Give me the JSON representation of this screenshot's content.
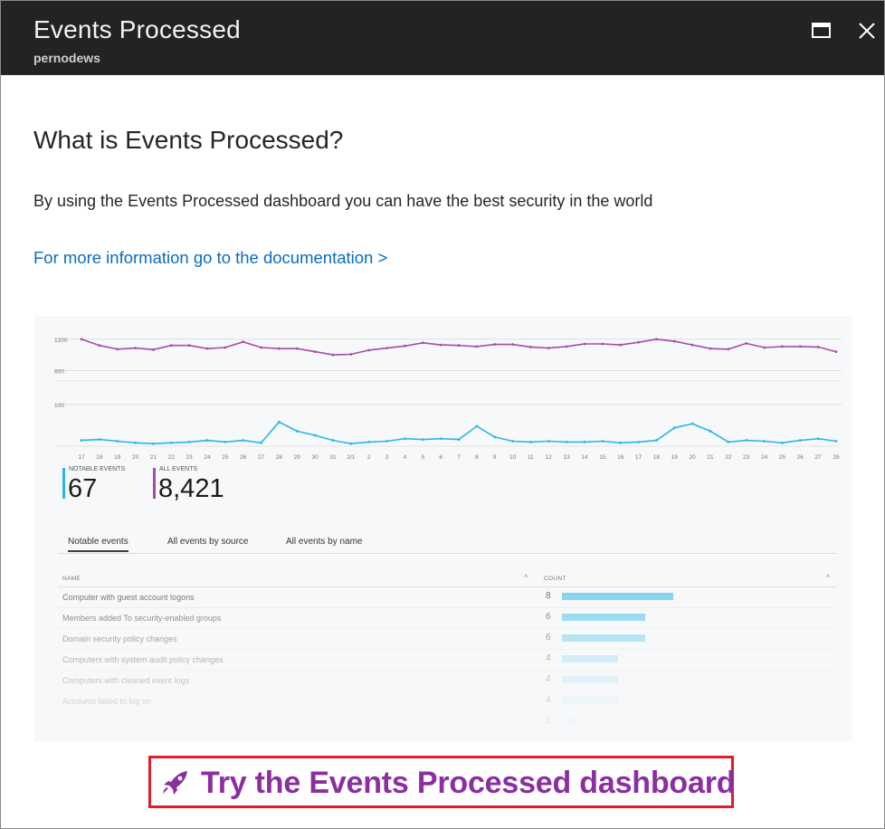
{
  "window": {
    "title": "Events Processed",
    "subtitle": "pernodews"
  },
  "content": {
    "heading": "What is Events Processed?",
    "description": "By using the Events Processed dashboard you can have the best security in the world",
    "doc_link": "For more information go to the documentation >"
  },
  "preview": {
    "notable": {
      "label": "NOTABLE EVENTS",
      "value": "67",
      "color": "#29b6e8"
    },
    "all": {
      "label": "ALL EVENTS",
      "value": "8,421",
      "color": "#a64ca6"
    },
    "tabs": [
      "Notable events",
      "All events by source",
      "All events by name"
    ],
    "columns": {
      "name": "NAME",
      "count": "COUNT"
    },
    "rows": [
      {
        "name": "Computer with guest account logons",
        "count": 8
      },
      {
        "name": "Members added To security-enabled groups",
        "count": 6
      },
      {
        "name": "Domain security policy changes",
        "count": 6
      },
      {
        "name": "Computers with system audit policy changes",
        "count": 4
      },
      {
        "name": "Computers with cleaned event logs",
        "count": 4
      },
      {
        "name": "Accounts failed to log on",
        "count": 4
      },
      {
        "name": "",
        "count": 1
      }
    ]
  },
  "chart_data": {
    "type": "line",
    "x": [
      "17",
      "18",
      "19",
      "20",
      "21",
      "22",
      "23",
      "24",
      "25",
      "26",
      "27",
      "28",
      "29",
      "30",
      "31",
      "2/1",
      "2",
      "3",
      "4",
      "5",
      "6",
      "7",
      "8",
      "9",
      "10",
      "11",
      "12",
      "13",
      "14",
      "15",
      "16",
      "17",
      "18",
      "19",
      "20",
      "21",
      "22",
      "23",
      "24",
      "25",
      "26",
      "27",
      "28"
    ],
    "panels": [
      {
        "yticks": [
          600,
          1200
        ],
        "ylim": [
          400,
          1300
        ],
        "series": [
          {
            "color": "#a64ca6",
            "values": [
              1200,
              1080,
              1010,
              1030,
              1000,
              1080,
              1080,
              1020,
              1040,
              1150,
              1040,
              1020,
              1020,
              960,
              900,
              910,
              990,
              1030,
              1070,
              1130,
              1090,
              1080,
              1060,
              1100,
              1100,
              1050,
              1030,
              1060,
              1110,
              1110,
              1090,
              1140,
              1200,
              1160,
              1090,
              1020,
              1010,
              1120,
              1040,
              1060,
              1060,
              1050,
              960
            ]
          }
        ]
      },
      {
        "yticks": [
          100
        ],
        "ylim": [
          0,
          100
        ],
        "series": [
          {
            "color": "#29b6e8",
            "values": [
              14,
              16,
              12,
              8,
              6,
              8,
              10,
              14,
              10,
              14,
              8,
              58,
              36,
              26,
              14,
              6,
              10,
              12,
              18,
              16,
              18,
              16,
              48,
              22,
              12,
              10,
              12,
              10,
              10,
              12,
              8,
              10,
              14,
              44,
              54,
              36,
              10,
              14,
              12,
              8,
              14,
              18,
              12
            ]
          }
        ]
      }
    ]
  },
  "cta": {
    "label": "Try the Events Processed dashboard"
  },
  "colors": {
    "titlebar": "#232323",
    "link": "#0b6cbd",
    "cta_text": "#8b2fa0",
    "cta_border": "#e41b2c"
  }
}
